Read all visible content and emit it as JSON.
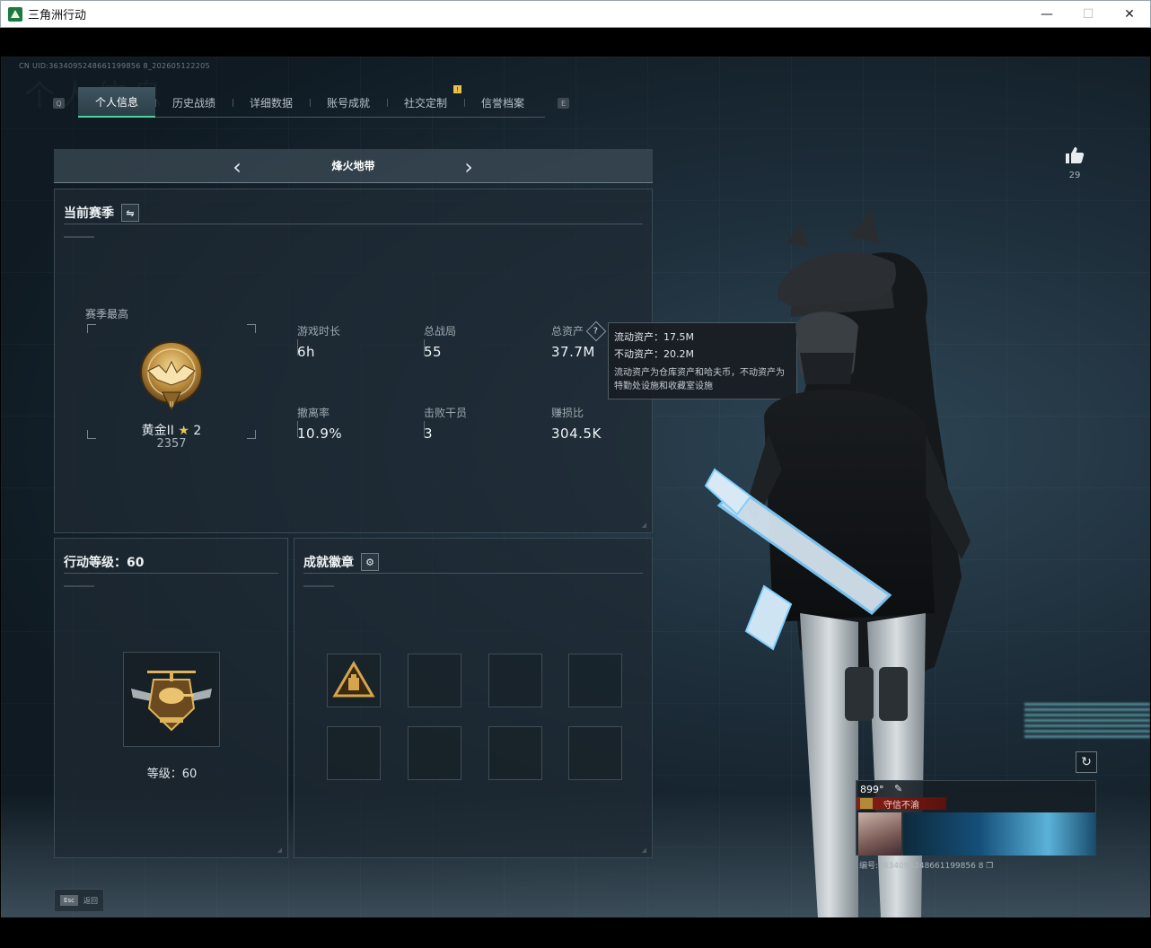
{
  "window": {
    "title": "三角洲行动",
    "controls": {
      "minimize": "—",
      "maximize": "☐",
      "close": "✕"
    }
  },
  "header": {
    "uid": "CN UID:3634095248661199856 8_202605122205",
    "ghost_title": "个人信息"
  },
  "tabs": {
    "left_key": "Q",
    "right_key": "E",
    "items": [
      {
        "label": "个人信息",
        "active": true
      },
      {
        "label": "历史战绩"
      },
      {
        "label": "详细数据"
      },
      {
        "label": "账号成就"
      },
      {
        "label": "社交定制",
        "notify": "!"
      },
      {
        "label": "信誉档案"
      }
    ]
  },
  "mode": {
    "prev": "‹",
    "label": "烽火地带",
    "next": "›"
  },
  "season": {
    "title": "当前赛季",
    "swap_icon": "⇋",
    "rank_caption": "赛季最高",
    "rank_name_prefix": "黄金II",
    "rank_star": "★",
    "rank_name_suffix": "2",
    "rank_score": "2357",
    "stats": [
      {
        "label": "游戏时长",
        "value": "6h"
      },
      {
        "label": "总战局",
        "value": "55"
      },
      {
        "label": "总资产",
        "value": "37.7M",
        "help": "?"
      },
      {
        "label": "撤离率",
        "value": "10.9%"
      },
      {
        "label": "击败干员",
        "value": "3"
      },
      {
        "label": "赚损比",
        "value": "304.5K"
      }
    ]
  },
  "tooltip": {
    "liquid": "流动资产：17.5M",
    "fixed": "不动资产：20.2M",
    "desc": "流动资产为仓库资产和哈夫币，不动资产为特勤处设施和收藏室设施"
  },
  "level": {
    "title": "行动等级：60",
    "text": "等级：60"
  },
  "achievement": {
    "title": "成就徽章",
    "settings_icon": "⚙"
  },
  "right": {
    "like_icon": "thumbs-up-icon",
    "like_count": "29",
    "refresh_icon": "↻",
    "card": {
      "name": "899°",
      "edit_icon": "✎",
      "tag": "守信不渝",
      "id": "编号:3634095248661199856 8"
    }
  },
  "footer": {
    "esc_key": "Esc",
    "esc_label": "返回"
  }
}
